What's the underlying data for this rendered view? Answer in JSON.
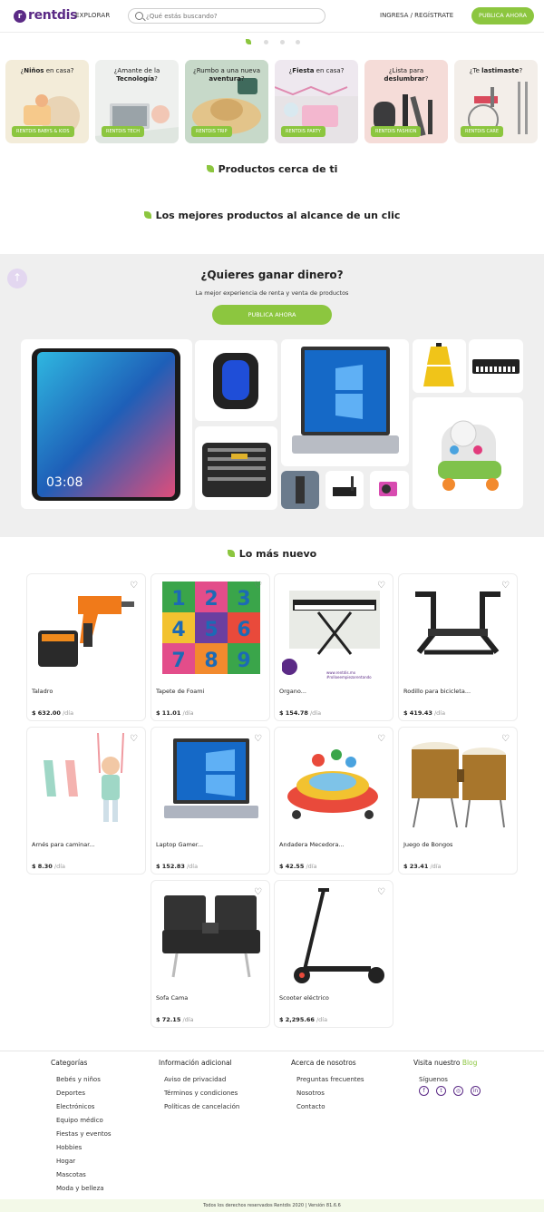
{
  "header": {
    "brand": "rentdis",
    "explore": "EXPLORAR",
    "search_placeholder": "¿Qué estás buscando?",
    "login": "INGRESA / REGÍSTRATE",
    "publish": "PUBLICA AHORA"
  },
  "categories": [
    {
      "pre": "¿",
      "bold": "Niños",
      "post": " en casa?",
      "tag": "RENTDIS BABYS & KIDS"
    },
    {
      "pre": "¿Amante de la ",
      "bold": "Tecnología",
      "post": "?",
      "tag": "RENTDIS TECH"
    },
    {
      "pre": "¿Rumbo a una nueva ",
      "bold": "aventura",
      "post": "?",
      "tag": "RENTDIS TRIP"
    },
    {
      "pre": "¿",
      "bold": "Fiesta",
      "post": " en casa?",
      "tag": "RENTDIS PARTY"
    },
    {
      "pre": "¿Lista para ",
      "bold": "deslumbrar",
      "post": "?",
      "tag": "RENTDIS FASHION"
    },
    {
      "pre": "¿Te ",
      "bold": "lastimaste",
      "post": "?",
      "tag": "RENTDIS CARE"
    }
  ],
  "sections": {
    "nearby": "Productos cerca de ti",
    "best": "Los mejores productos al alcance de un clic",
    "newest": "Lo más nuevo"
  },
  "earn": {
    "title": "¿Quieres ganar dinero?",
    "subtitle": "La mejor experiencia de renta y venta de productos",
    "button": "PUBLICA AHORA",
    "phone_time": "03:08"
  },
  "products": [
    {
      "name": "Taladro",
      "price": "$ 632.00",
      "unit": "/día"
    },
    {
      "name": "Tapete de Foami",
      "price": "$ 11.01",
      "unit": "/día"
    },
    {
      "name": "Organo...",
      "price": "$ 154.78",
      "unit": "/día"
    },
    {
      "name": "Rodillo para bicicleta...",
      "price": "$ 419.43",
      "unit": "/día"
    },
    {
      "name": "Arnés para caminar...",
      "price": "$ 8.30",
      "unit": "/día"
    },
    {
      "name": "Laptop Gamer...",
      "price": "$ 152.83",
      "unit": "/día"
    },
    {
      "name": "Andadera Mecedora...",
      "price": "$ 42.55",
      "unit": "/día"
    },
    {
      "name": "Juego de Bongos",
      "price": "$ 23.41",
      "unit": "/día"
    },
    {
      "name": "Sofa Cama",
      "price": "$ 72.15",
      "unit": "/día"
    },
    {
      "name": "Scooter eléctrico",
      "price": "$ 2,295.66",
      "unit": "/día"
    }
  ],
  "organ_caption": "www.rentdis.mx\n#rolloeempiezarentando",
  "footer": {
    "col1_title": "Categorías",
    "col1": [
      "Bebés y niños",
      "Deportes",
      "Electrónicos",
      "Equipo médico",
      "Fiestas y eventos",
      "Hobbies",
      "Hogar",
      "Mascotas",
      "Moda y belleza"
    ],
    "col2_title": "Información adicional",
    "col2": [
      "Aviso de privacidad",
      "Términos y condiciones",
      "Políticas de cancelación"
    ],
    "col3_title": "Acerca de nosotros",
    "col3": [
      "Preguntas frecuentes",
      "Nosotros",
      "Contacto"
    ],
    "col4_title": "Visita nuestro ",
    "col4_link": "Blog",
    "follow": "Síguenos",
    "copyright": "Todos los derechos reservados Rentdis 2020 | Versión 81.6.6"
  },
  "colors": {
    "brand_purple": "#5b2a86",
    "accent_green": "#8cc63f"
  }
}
